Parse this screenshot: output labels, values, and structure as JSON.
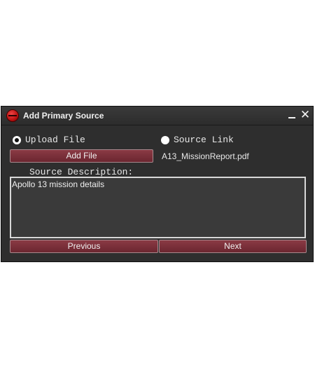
{
  "dialog": {
    "title": "Add Primary Source",
    "close_glyph": "✕",
    "icons": {
      "app": "app-logo-icon",
      "minimize": "minimize-icon",
      "close": "close-icon"
    }
  },
  "source_type": {
    "upload_label": "Upload File",
    "link_label": "Source Link",
    "selected": "upload"
  },
  "upload": {
    "button_label": "Add File",
    "file_name": "A13_MissionReport.pdf"
  },
  "description": {
    "label": "Source Description:",
    "value": "Apollo 13 mission details"
  },
  "nav": {
    "previous_label": "Previous",
    "next_label": "Next"
  },
  "colors": {
    "background": "#2e2e2e",
    "button": "#7a2f39",
    "text": "#e8e8e8"
  }
}
